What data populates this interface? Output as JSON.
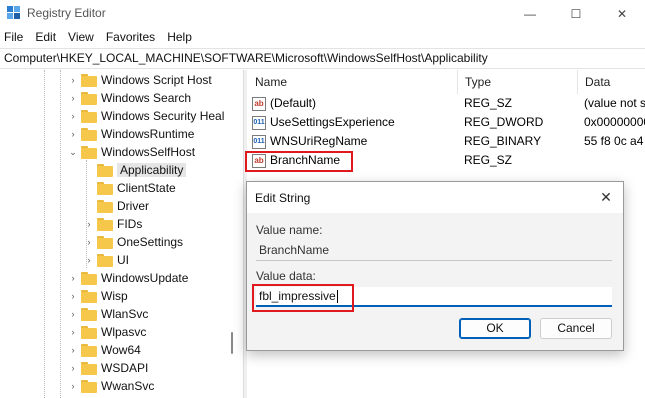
{
  "window": {
    "title": "Registry Editor",
    "minimize_glyph": "—",
    "maximize_glyph": "☐",
    "close_glyph": "✕"
  },
  "menu": [
    "File",
    "Edit",
    "View",
    "Favorites",
    "Help"
  ],
  "address": "Computer\\HKEY_LOCAL_MACHINE\\SOFTWARE\\Microsoft\\WindowsSelfHost\\Applicability",
  "tree": {
    "items": [
      {
        "label": "Windows Script Host",
        "chevron": "›"
      },
      {
        "label": "Windows Search",
        "chevron": "›"
      },
      {
        "label": "Windows Security Heal",
        "chevron": "›"
      },
      {
        "label": "WindowsRuntime",
        "chevron": "›"
      },
      {
        "label": "WindowsSelfHost",
        "chevron": "⌄"
      },
      {
        "label": "Applicability",
        "chevron": "",
        "selected": true
      },
      {
        "label": "ClientState",
        "chevron": ""
      },
      {
        "label": "Driver",
        "chevron": ""
      },
      {
        "label": "FIDs",
        "chevron": "›"
      },
      {
        "label": "OneSettings",
        "chevron": "›"
      },
      {
        "label": "UI",
        "chevron": "›"
      },
      {
        "label": "WindowsUpdate",
        "chevron": "›"
      },
      {
        "label": "Wisp",
        "chevron": "›"
      },
      {
        "label": "WlanSvc",
        "chevron": "›"
      },
      {
        "label": "Wlpasvc",
        "chevron": "›"
      },
      {
        "label": "Wow64",
        "chevron": "›"
      },
      {
        "label": "WSDAPI",
        "chevron": "›"
      },
      {
        "label": "WwanSvc",
        "chevron": "›"
      }
    ]
  },
  "list": {
    "columns": {
      "name": "Name",
      "type": "Type",
      "data": "Data"
    },
    "rows": [
      {
        "icon": "ab",
        "name": "(Default)",
        "type": "REG_SZ",
        "data": "(value not s"
      },
      {
        "icon": "011",
        "name": "UseSettingsExperience",
        "type": "REG_DWORD",
        "data": "0x00000000"
      },
      {
        "icon": "011",
        "name": "WNSUriRegName",
        "type": "REG_BINARY",
        "data": "55 f8 0c a4"
      },
      {
        "icon": "ab",
        "name": "BranchName",
        "type": "REG_SZ",
        "data": ""
      }
    ]
  },
  "dialog": {
    "title": "Edit String",
    "close_glyph": "✕",
    "value_name_label": "Value name:",
    "value_name": "BranchName",
    "value_data_label": "Value data:",
    "value_data": "fbl_impressive",
    "ok_label": "OK",
    "cancel_label": "Cancel"
  },
  "colors": {
    "annotation_red": "#e0191e",
    "focus_blue": "#005fb8",
    "folder_yellow": "#f5c84c"
  }
}
